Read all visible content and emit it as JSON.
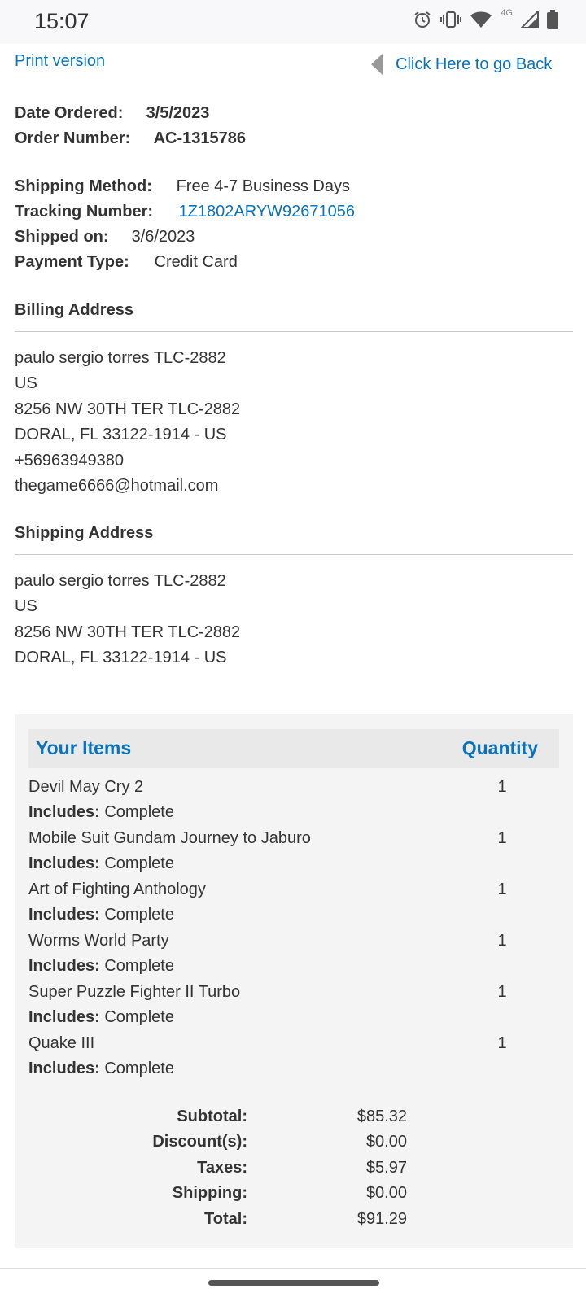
{
  "status_bar": {
    "time": "15:07",
    "icons": [
      "alarm-icon",
      "vibrate-icon",
      "wifi-icon",
      "4g-icon",
      "signal-icon",
      "battery-icon"
    ],
    "network_label": "4G"
  },
  "nav": {
    "print_label": "Print version",
    "back_label": "Click Here to go Back"
  },
  "order": {
    "date_label": "Date Ordered:",
    "date_value": "3/5/2023",
    "number_label": "Order Number:",
    "number_value": "AC-1315786",
    "shipping_method_label": "Shipping Method:",
    "shipping_method_value": "Free 4-7 Business Days",
    "tracking_label": "Tracking Number:",
    "tracking_value": "1Z1802ARYW92671056",
    "shipped_label": "Shipped on:",
    "shipped_value": "3/6/2023",
    "payment_label": "Payment Type:",
    "payment_value": "Credit Card"
  },
  "billing": {
    "title": "Billing Address",
    "lines": [
      "paulo sergio torres TLC-2882",
      "US",
      "8256 NW 30TH TER TLC-2882",
      "DORAL, FL 33122-1914 - US",
      "+56963949380",
      "thegame6666@hotmail.com"
    ]
  },
  "shipping": {
    "title": "Shipping Address",
    "lines": [
      "paulo sergio torres TLC-2882",
      "US",
      "8256 NW 30TH TER TLC-2882",
      "DORAL, FL 33122-1914 - US"
    ]
  },
  "items": {
    "header_items": "Your Items",
    "header_quantity": "Quantity",
    "includes_label": "Includes:",
    "list": [
      {
        "name": "Devil May Cry 2",
        "includes": "Complete",
        "qty": "1"
      },
      {
        "name": "Mobile Suit Gundam Journey to Jaburo",
        "includes": "Complete",
        "qty": "1"
      },
      {
        "name": "Art of Fighting Anthology",
        "includes": "Complete",
        "qty": "1"
      },
      {
        "name": "Worms World Party",
        "includes": "Complete",
        "qty": "1"
      },
      {
        "name": "Super Puzzle Fighter II Turbo",
        "includes": "Complete",
        "qty": "1"
      },
      {
        "name": "Quake III",
        "includes": "Complete",
        "qty": "1"
      }
    ]
  },
  "totals": {
    "subtotal_label": "Subtotal:",
    "subtotal_value": "$85.32",
    "discount_label": "Discount(s):",
    "discount_value": "$0.00",
    "taxes_label": "Taxes:",
    "taxes_value": "$5.97",
    "shipping_label": "Shipping:",
    "shipping_value": "$0.00",
    "total_label": "Total:",
    "total_value": "$91.29"
  },
  "colors": {
    "link": "#0a72ba",
    "text": "#333333",
    "panel": "#f4f4f4",
    "panel_header": "#e9e9e9"
  }
}
